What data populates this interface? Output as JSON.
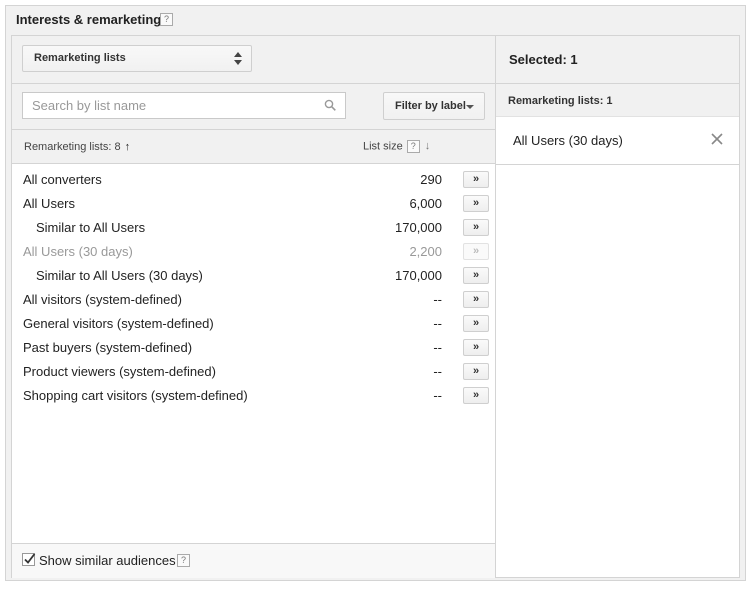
{
  "section": {
    "title": "Interests & remarketing",
    "help": "?"
  },
  "left": {
    "dropdown_label": "Remarketing lists",
    "search_placeholder": "Search by list name",
    "filter_label": "Filter by label",
    "header": {
      "name_label": "Remarketing lists: 8",
      "name_sort": "↑",
      "size_label": "List size",
      "size_help": "?",
      "size_sort": "↓"
    },
    "add_label": "»",
    "rows": [
      {
        "name": "All converters",
        "size": "290",
        "indent": false,
        "disabled": false
      },
      {
        "name": "All Users",
        "size": "6,000",
        "indent": false,
        "disabled": false
      },
      {
        "name": "Similar to All Users",
        "size": "170,000",
        "indent": true,
        "disabled": false
      },
      {
        "name": "All Users (30 days)",
        "size": "2,200",
        "indent": false,
        "disabled": true
      },
      {
        "name": "Similar to All Users (30 days)",
        "size": "170,000",
        "indent": true,
        "disabled": false
      },
      {
        "name": "All visitors (system-defined)",
        "size": "--",
        "indent": false,
        "disabled": false
      },
      {
        "name": "General visitors (system-defined)",
        "size": "--",
        "indent": false,
        "disabled": false
      },
      {
        "name": "Past buyers (system-defined)",
        "size": "--",
        "indent": false,
        "disabled": false
      },
      {
        "name": "Product viewers (system-defined)",
        "size": "--",
        "indent": false,
        "disabled": false
      },
      {
        "name": "Shopping cart visitors (system-defined)",
        "size": "--",
        "indent": false,
        "disabled": false
      }
    ],
    "footer": {
      "checkbox_label": "Show similar audiences",
      "checked": true,
      "help": "?"
    }
  },
  "right": {
    "selected_label": "Selected: 1",
    "group_label": "Remarketing lists: 1",
    "selected_items": [
      "All Users (30 days)"
    ]
  }
}
